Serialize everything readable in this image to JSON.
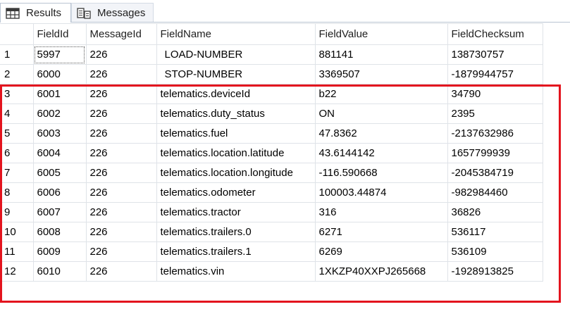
{
  "tabs": [
    {
      "label": "Results",
      "icon": "grid-icon",
      "active": true
    },
    {
      "label": "Messages",
      "icon": "messages-icon",
      "active": false
    }
  ],
  "columns": [
    "",
    "FieldId",
    "MessageId",
    "FieldName",
    "FieldValue",
    "FieldChecksum"
  ],
  "rows": [
    {
      "num": "1",
      "field_id": "5997",
      "message_id": "226",
      "field_name": "LOAD-NUMBER",
      "field_value": "881141",
      "checksum": "138730757"
    },
    {
      "num": "2",
      "field_id": "6000",
      "message_id": "226",
      "field_name": "STOP-NUMBER",
      "field_value": "3369507",
      "checksum": "-1879944757"
    },
    {
      "num": "3",
      "field_id": "6001",
      "message_id": "226",
      "field_name": "telematics.deviceId",
      "field_value": "b22",
      "checksum": "34790"
    },
    {
      "num": "4",
      "field_id": "6002",
      "message_id": "226",
      "field_name": "telematics.duty_status",
      "field_value": "ON",
      "checksum": "2395"
    },
    {
      "num": "5",
      "field_id": "6003",
      "message_id": "226",
      "field_name": "telematics.fuel",
      "field_value": "47.8362",
      "checksum": "-2137632986"
    },
    {
      "num": "6",
      "field_id": "6004",
      "message_id": "226",
      "field_name": "telematics.location.latitude",
      "field_value": "43.6144142",
      "checksum": "1657799939"
    },
    {
      "num": "7",
      "field_id": "6005",
      "message_id": "226",
      "field_name": "telematics.location.longitude",
      "field_value": "-116.590668",
      "checksum": "-2045384719"
    },
    {
      "num": "8",
      "field_id": "6006",
      "message_id": "226",
      "field_name": "telematics.odometer",
      "field_value": "100003.44874",
      "checksum": "-982984460"
    },
    {
      "num": "9",
      "field_id": "6007",
      "message_id": "226",
      "field_name": "telematics.tractor",
      "field_value": "316",
      "checksum": "36826"
    },
    {
      "num": "10",
      "field_id": "6008",
      "message_id": "226",
      "field_name": "telematics.trailers.0",
      "field_value": "6271",
      "checksum": "536117"
    },
    {
      "num": "11",
      "field_id": "6009",
      "message_id": "226",
      "field_name": "telematics.trailers.1",
      "field_value": "6269",
      "checksum": "536109"
    },
    {
      "num": "12",
      "field_id": "6010",
      "message_id": "226",
      "field_name": "telematics.vin",
      "field_value": "1XKZP40XXPJ265668",
      "checksum": "-1928913825"
    }
  ],
  "selected_cell": {
    "row": "1",
    "column": "FieldId"
  },
  "highlight": {
    "color": "#e3141e",
    "from_row": "3",
    "to_row": "12"
  }
}
